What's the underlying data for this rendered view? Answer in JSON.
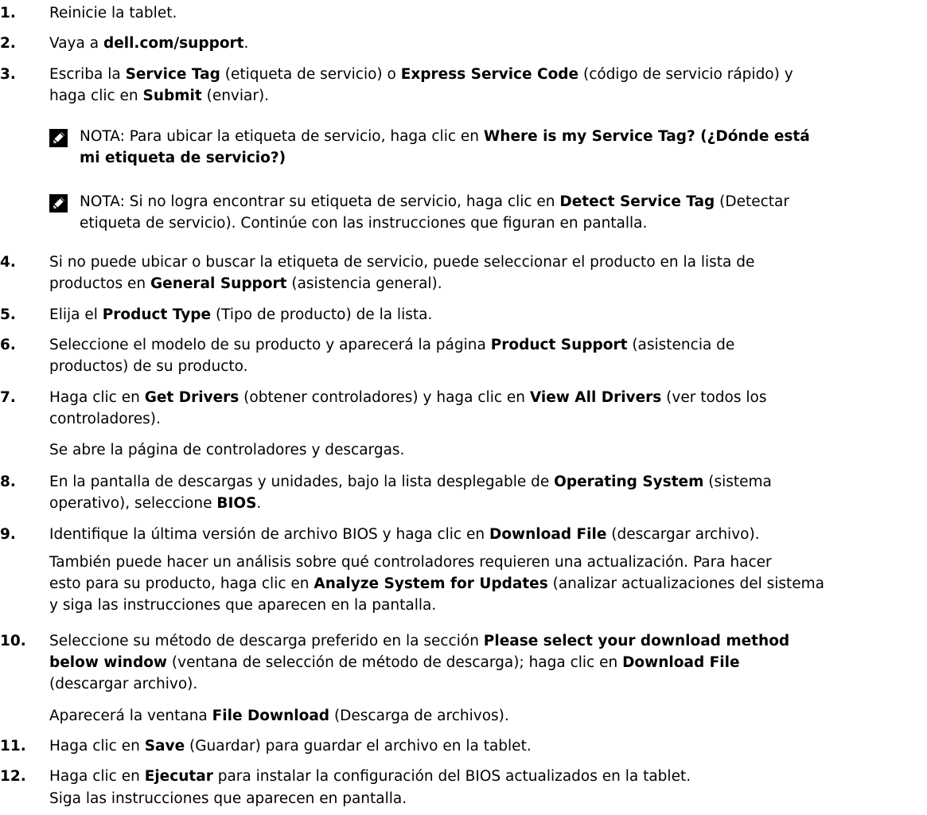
{
  "colors": {
    "text": "#000000",
    "icon": "#000000",
    "background": "#ffffff"
  },
  "steps": [
    {
      "num": "1.",
      "lines": [
        [
          {
            "t": "Reinicie la tablet."
          }
        ]
      ]
    },
    {
      "num": "2.",
      "lines": [
        [
          {
            "t": "Vaya a "
          },
          {
            "t": "dell.com/support",
            "b": true
          },
          {
            "t": "."
          }
        ]
      ]
    },
    {
      "num": "3.",
      "lines": [
        [
          {
            "t": "Escriba la "
          },
          {
            "t": "Service Tag",
            "b": true
          },
          {
            "t": " (etiqueta de servicio) o "
          },
          {
            "t": "Express Service Code",
            "b": true
          },
          {
            "t": " (código de servicio rápido) y"
          }
        ],
        [
          {
            "t": "haga clic en "
          },
          {
            "t": "Submit",
            "b": true
          },
          {
            "t": " (enviar)."
          }
        ]
      ]
    },
    {
      "num": "4.",
      "lines": [
        [
          {
            "t": "Si no puede ubicar o buscar la etiqueta de servicio, puede seleccionar el producto en la lista de"
          }
        ],
        [
          {
            "t": "productos en "
          },
          {
            "t": "General Support",
            "b": true
          },
          {
            "t": " (asistencia general)."
          }
        ]
      ]
    },
    {
      "num": "5.",
      "lines": [
        [
          {
            "t": "Elija el "
          },
          {
            "t": "Product Type",
            "b": true
          },
          {
            "t": " (Tipo de producto) de la lista."
          }
        ]
      ]
    },
    {
      "num": "6.",
      "lines": [
        [
          {
            "t": "Seleccione el modelo de su producto y aparecerá la página "
          },
          {
            "t": "Product Support",
            "b": true
          },
          {
            "t": " (asistencia de"
          }
        ],
        [
          {
            "t": "productos) de su producto."
          }
        ]
      ]
    },
    {
      "num": "7.",
      "lines": [
        [
          {
            "t": "Haga clic en "
          },
          {
            "t": "Get Drivers",
            "b": true
          },
          {
            "t": " (obtener controladores) y haga clic en "
          },
          {
            "t": "View All Drivers",
            "b": true
          },
          {
            "t": " (ver todos los"
          }
        ],
        [
          {
            "t": "controladores)."
          }
        ]
      ]
    },
    {
      "num": "8.",
      "lines": [
        [
          {
            "t": "En la pantalla de descargas y unidades, bajo la lista desplegable de "
          },
          {
            "t": "Operating System",
            "b": true
          },
          {
            "t": " (sistema"
          }
        ],
        [
          {
            "t": "operativo), seleccione "
          },
          {
            "t": "BIOS",
            "b": true
          },
          {
            "t": "."
          }
        ]
      ]
    },
    {
      "num": "9.",
      "lines": [
        [
          {
            "t": "Identifique la última versión de archivo BIOS y haga clic en "
          },
          {
            "t": "Download File",
            "b": true
          },
          {
            "t": " (descargar archivo)."
          }
        ]
      ]
    },
    {
      "num": "10.",
      "lines": [
        [
          {
            "t": "Seleccione su método de descarga preferido en la sección "
          },
          {
            "t": "Please select your download method",
            "b": true
          }
        ],
        [
          {
            "t": "below window",
            "b": true
          },
          {
            "t": " (ventana de selección de método de descarga); haga clic en "
          },
          {
            "t": "Download File",
            "b": true
          }
        ],
        [
          {
            "t": "(descargar archivo)."
          }
        ]
      ]
    },
    {
      "num": "11.",
      "lines": [
        [
          {
            "t": "Haga clic en "
          },
          {
            "t": "Save",
            "b": true
          },
          {
            "t": " (Guardar) para guardar el archivo en la tablet."
          }
        ]
      ]
    },
    {
      "num": "12.",
      "lines": [
        [
          {
            "t": "Haga clic en "
          },
          {
            "t": "Ejecutar",
            "b": true
          },
          {
            "t": " para instalar la configuración del BIOS actualizados en la tablet."
          }
        ]
      ]
    }
  ],
  "notes": [
    {
      "icon": "pencil-icon",
      "lines": [
        [
          {
            "t": "NOTA:",
            "b2": true
          },
          {
            "t": " Para ubicar la etiqueta de servicio, haga clic en "
          },
          {
            "t": "Where is my Service Tag? (¿Dónde está",
            "b": true
          }
        ],
        [
          {
            "t": "mi etiqueta de servicio?)",
            "b": true
          }
        ]
      ]
    },
    {
      "icon": "pencil-icon",
      "lines": [
        [
          {
            "t": "NOTA:",
            "b2": true
          },
          {
            "t": " Si no logra encontrar su etiqueta de servicio, haga clic en "
          },
          {
            "t": "Detect Service Tag",
            "b": true
          },
          {
            "t": " (Detectar"
          }
        ],
        [
          {
            "t": "etiqueta de servicio). Continúe con las instrucciones que figuran en pantalla."
          }
        ]
      ]
    }
  ],
  "subs": [
    {
      "id": "after-7",
      "lines": [
        [
          {
            "t": "Se abre la página de controladores y descargas."
          }
        ]
      ]
    },
    {
      "id": "after-9",
      "lines": [
        [
          {
            "t": "También puede hacer un análisis sobre qué controladores requieren una actualización. Para hacer"
          }
        ],
        [
          {
            "t": "esto para su producto, haga clic en "
          },
          {
            "t": "Analyze System for Updates",
            "b": true
          },
          {
            "t": " (analizar actualizaciones del sistema"
          }
        ],
        [
          {
            "t": "y siga las instrucciones que aparecen en la pantalla."
          }
        ]
      ]
    },
    {
      "id": "after-10",
      "lines": [
        [
          {
            "t": "Aparecerá la ventana "
          },
          {
            "t": "File Download",
            "b": true
          },
          {
            "t": " (Descarga de archivos)."
          }
        ]
      ]
    },
    {
      "id": "after-12",
      "lines": [
        [
          {
            "t": "Siga las instrucciones que aparecen en pantalla."
          }
        ]
      ]
    }
  ]
}
